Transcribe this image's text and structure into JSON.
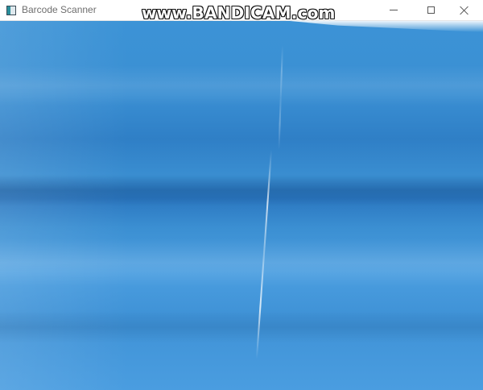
{
  "window": {
    "title": "Barcode Scanner",
    "icon": "app-icon",
    "controls": {
      "minimize_icon": "minimize-icon",
      "maximize_icon": "maximize-icon",
      "close_icon": "close-icon"
    }
  },
  "overlay": {
    "watermark": "www.BANDICAM.com"
  },
  "colors": {
    "camera_blue": "#3a8fd3",
    "titlebar": "#ffffff"
  }
}
